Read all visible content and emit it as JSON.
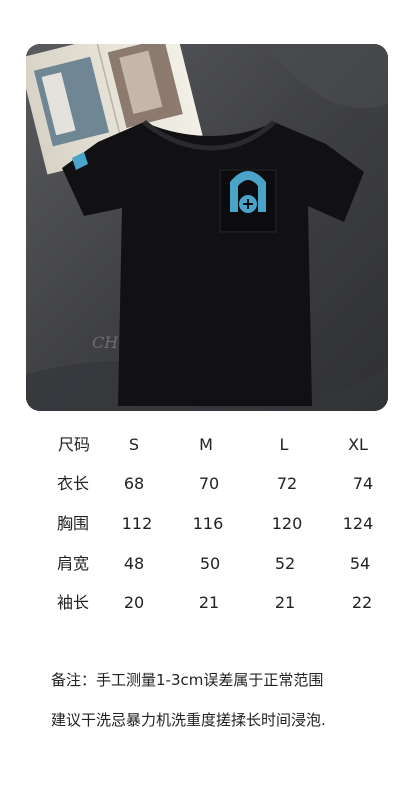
{
  "photo": {
    "alt_label": "",
    "chest_logo_text": "",
    "sleeve_monogram": "CH"
  },
  "size_table": {
    "headers": [
      "尺码",
      "S",
      "M",
      "L",
      "XL"
    ],
    "rows": [
      {
        "label": "衣长",
        "values": [
          "68",
          "70",
          "72",
          "74"
        ]
      },
      {
        "label": "胸围",
        "values": [
          "112",
          "116",
          "120",
          "124"
        ]
      },
      {
        "label": "肩宽",
        "values": [
          "48",
          "50",
          "52",
          "54"
        ]
      },
      {
        "label": "袖长",
        "values": [
          "20",
          "21",
          "21",
          "22"
        ]
      }
    ]
  },
  "notes": [
    "备注：手工测量1-3cm误差属于正常范围",
    "建议干洗忌暴力机洗重度搓揉长时间浸泡."
  ],
  "colors": {
    "background": "#ffffff",
    "text": "#222222",
    "shirt": "#111113",
    "logo_blue": "#4aa3c8"
  }
}
